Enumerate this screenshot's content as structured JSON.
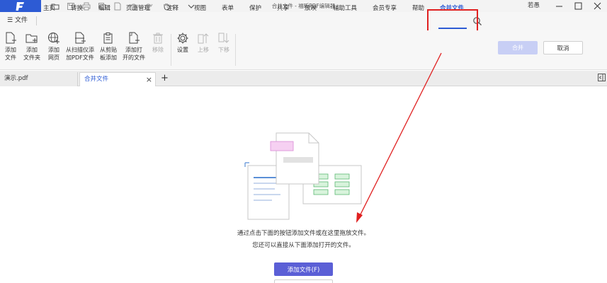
{
  "titlebar": {
    "window_title": "合并文件 - 福昕PDF编辑器",
    "user": "若愚",
    "quick_access_icons": [
      "folder-icon",
      "save-icon",
      "print-icon",
      "copy-icon",
      "undo-icon",
      "redo-icon",
      "hand-icon",
      "dropdown-icon"
    ]
  },
  "menubar": {
    "file": "文件",
    "items": [
      "主页",
      "转换",
      "编辑",
      "页面管理",
      "注释",
      "视图",
      "表单",
      "保护",
      "共享",
      "放映",
      "辅助工具",
      "会员专享",
      "帮助",
      "合并文件"
    ],
    "active": "合并文件"
  },
  "ribbon": {
    "buttons": [
      {
        "label1": "添加",
        "label2": "文件",
        "icon": "add-file-icon",
        "enabled": true
      },
      {
        "label1": "添加",
        "label2": "文件夹",
        "icon": "add-folder-icon",
        "enabled": true
      },
      {
        "label1": "添加",
        "label2": "网页",
        "icon": "add-web-icon",
        "enabled": true
      },
      {
        "label1": "从扫描仪添",
        "label2": "加PDF文件",
        "icon": "scanner-icon",
        "enabled": true
      },
      {
        "label1": "从剪贴",
        "label2": "板添加",
        "icon": "clipboard-icon",
        "enabled": true
      },
      {
        "label1": "添加打",
        "label2": "开的文件",
        "icon": "add-open-file-icon",
        "enabled": true
      },
      {
        "label1": "移除",
        "label2": "",
        "icon": "remove-icon",
        "enabled": false
      },
      {
        "label1": "设置",
        "label2": "",
        "icon": "settings-icon",
        "enabled": true
      },
      {
        "label1": "上移",
        "label2": "",
        "icon": "move-up-icon",
        "enabled": false
      },
      {
        "label1": "下移",
        "label2": "",
        "icon": "move-down-icon",
        "enabled": false
      }
    ],
    "merge_button": "合并",
    "cancel_button": "取消"
  },
  "tabs": [
    {
      "label": "演示.pdf",
      "active": false
    },
    {
      "label": "合并文件",
      "active": true,
      "close": "×"
    }
  ],
  "tab_add": "+",
  "content": {
    "hint_line1": "通过点击下面的按钮添加文件或在这里拖放文件。",
    "hint_line2": "您还可以直接从下面添加打开的文件。",
    "add_file_button": "添加文件(F)"
  },
  "colors": {
    "accent": "#2d5bd4",
    "annotation_red": "#e02020",
    "primary_button": "#5b5fd6"
  }
}
